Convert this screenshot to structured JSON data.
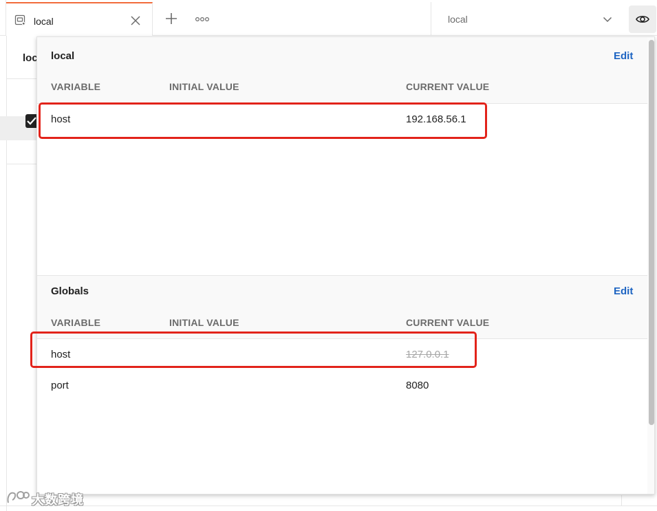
{
  "tabs": {
    "active_label": "local",
    "icon": "environment-icon"
  },
  "environment_selector": {
    "selected": "local"
  },
  "background": {
    "heading_fragment": "loc"
  },
  "popover": {
    "sections": [
      {
        "title": "local",
        "edit_label": "Edit",
        "columns": [
          "VARIABLE",
          "INITIAL VALUE",
          "CURRENT VALUE"
        ],
        "rows": [
          {
            "variable": "host",
            "initial_value": "",
            "current_value": "192.168.56.1",
            "overridden": false
          }
        ]
      },
      {
        "title": "Globals",
        "edit_label": "Edit",
        "columns": [
          "VARIABLE",
          "INITIAL VALUE",
          "CURRENT VALUE"
        ],
        "rows": [
          {
            "variable": "host",
            "initial_value": "",
            "current_value": "127.0.0.1",
            "overridden": true
          },
          {
            "variable": "port",
            "initial_value": "",
            "current_value": "8080",
            "overridden": false
          }
        ]
      }
    ]
  },
  "watermark": {
    "text": "大数跨境"
  },
  "colors": {
    "tab_accent": "#f26b3a",
    "edit_link": "#1d64c2",
    "annotation": "#e2231a",
    "overridden_text": "#a6a6a6"
  }
}
